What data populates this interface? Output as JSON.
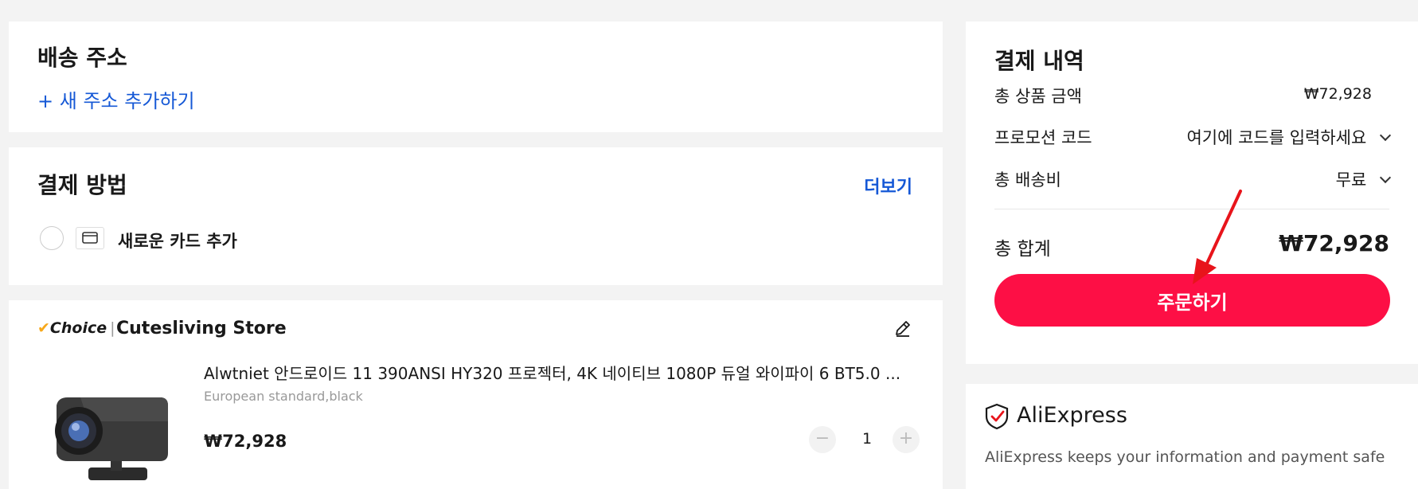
{
  "shipping": {
    "title": "배송 주소",
    "add_address": "+ 새 주소 추가하기"
  },
  "payment": {
    "title": "결제 방법",
    "more": "더보기",
    "new_card": "새로운 카드 추가"
  },
  "store": {
    "badge": "Choice",
    "name": "Cutesliving Store"
  },
  "product": {
    "title": "Alwtniet 안드로이드 11 390ANSI HY320 프로젝터, 4K 네이티브 1080P 듀얼 와이파이 6 BT5.0 ...",
    "variant": "European standard,black",
    "price": "₩72,928",
    "quantity": "1",
    "minus": "−",
    "plus": "+"
  },
  "summary": {
    "title": "결제 내역",
    "subtotal_label": "총 상품 금액",
    "subtotal_value": "₩72,928",
    "promo_label": "프로모션 코드",
    "promo_placeholder": "여기에 코드를 입력하세요",
    "shipping_label": "총 배송비",
    "shipping_value": "무료",
    "total_label": "총 합계",
    "total_value": "₩72,928",
    "order_button": "주문하기"
  },
  "trust": {
    "brand": "AliExpress",
    "message": "AliExpress keeps your information and payment safe"
  },
  "colors": {
    "accent": "#fd0f45",
    "link": "#1558d6",
    "choice": "#f7a81b"
  }
}
